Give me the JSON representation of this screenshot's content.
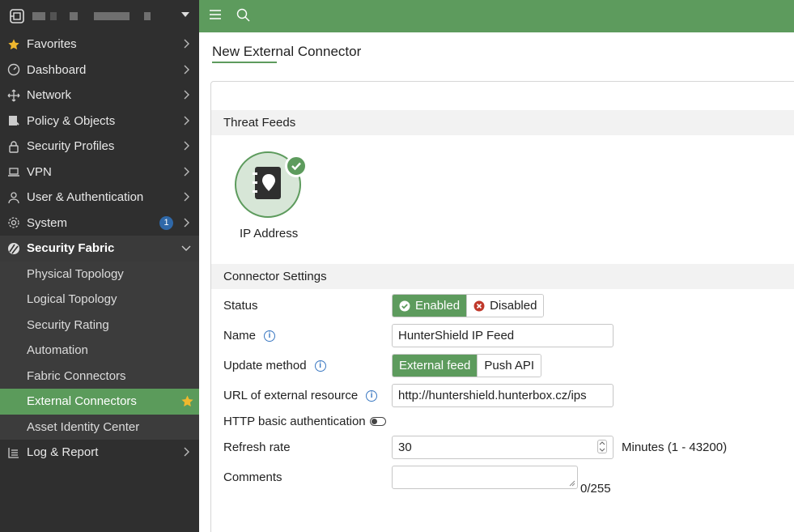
{
  "sidebar": {
    "items": [
      {
        "label": "Favorites",
        "icon": "star-icon"
      },
      {
        "label": "Dashboard",
        "icon": "dashboard-icon"
      },
      {
        "label": "Network",
        "icon": "network-icon"
      },
      {
        "label": "Policy & Objects",
        "icon": "policy-icon"
      },
      {
        "label": "Security Profiles",
        "icon": "lock-icon"
      },
      {
        "label": "VPN",
        "icon": "laptop-icon"
      },
      {
        "label": "User & Authentication",
        "icon": "user-icon"
      },
      {
        "label": "System",
        "icon": "gear-icon",
        "badge": "1"
      },
      {
        "label": "Security Fabric",
        "icon": "fabric-icon"
      }
    ],
    "sub_items": [
      {
        "label": "Physical Topology"
      },
      {
        "label": "Logical Topology"
      },
      {
        "label": "Security Rating"
      },
      {
        "label": "Automation"
      },
      {
        "label": "Fabric Connectors"
      },
      {
        "label": "External Connectors"
      },
      {
        "label": "Asset Identity Center"
      }
    ],
    "bottom_item": {
      "label": "Log & Report",
      "icon": "report-icon"
    }
  },
  "topbar": {
    "menu_icon": "hamburger-icon",
    "search_icon": "search-icon",
    "color": "#5d9b5d"
  },
  "page": {
    "title": "New External Connector"
  },
  "threat_feeds": {
    "heading": "Threat Feeds",
    "tile_label": "IP Address",
    "tile_icon": "address-book-icon"
  },
  "connector_settings": {
    "heading": "Connector Settings",
    "status": {
      "label": "Status",
      "enabled": "Enabled",
      "disabled": "Disabled",
      "selected": "Enabled"
    },
    "name": {
      "label": "Name",
      "value": "HunterShield IP Feed"
    },
    "update_method": {
      "label": "Update method",
      "external": "External feed",
      "push": "Push API",
      "selected": "External feed"
    },
    "url": {
      "label": "URL of external resource",
      "value": "http://huntershield.hunterbox.cz/ips"
    },
    "http_auth": {
      "label": "HTTP basic authentication",
      "enabled": false
    },
    "refresh": {
      "label": "Refresh rate",
      "value": "30",
      "unit": "Minutes (1 - 43200)"
    },
    "comments": {
      "label": "Comments",
      "value": "",
      "counter": "0/255"
    }
  }
}
